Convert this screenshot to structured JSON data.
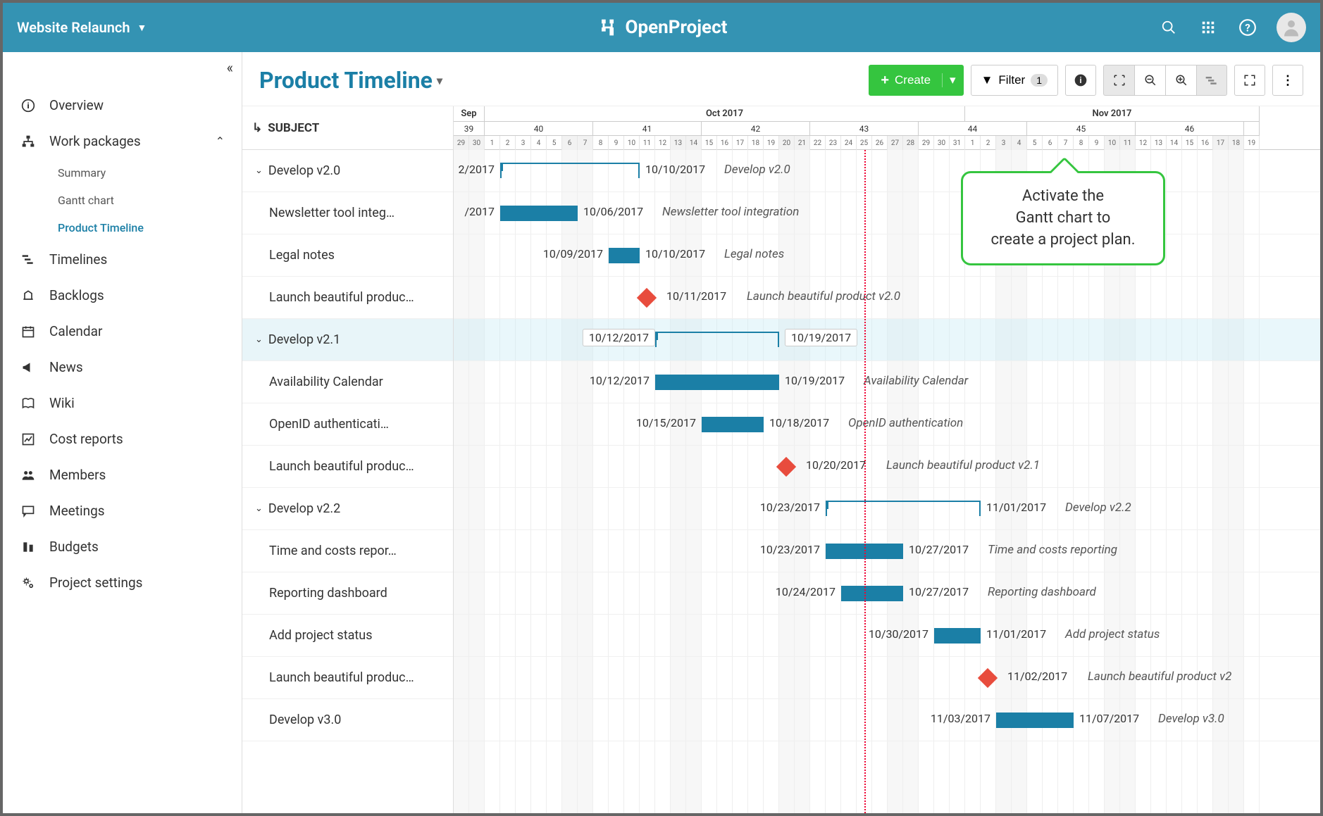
{
  "header": {
    "project_name": "Website Relaunch",
    "brand": "OpenProject"
  },
  "sidebar": {
    "items": [
      {
        "key": "overview",
        "label": "Overview",
        "icon": "info-circle"
      },
      {
        "key": "workpackages",
        "label": "Work packages",
        "icon": "sitemap",
        "expanded": true,
        "children": [
          {
            "key": "summary",
            "label": "Summary"
          },
          {
            "key": "gantt",
            "label": "Gantt chart"
          },
          {
            "key": "timeline",
            "label": "Product Timeline",
            "active": true
          }
        ]
      },
      {
        "key": "timelines",
        "label": "Timelines",
        "icon": "timeline"
      },
      {
        "key": "backlogs",
        "label": "Backlogs",
        "icon": "backlog"
      },
      {
        "key": "calendar",
        "label": "Calendar",
        "icon": "calendar"
      },
      {
        "key": "news",
        "label": "News",
        "icon": "bullhorn"
      },
      {
        "key": "wiki",
        "label": "Wiki",
        "icon": "book"
      },
      {
        "key": "costreports",
        "label": "Cost reports",
        "icon": "chart"
      },
      {
        "key": "members",
        "label": "Members",
        "icon": "members"
      },
      {
        "key": "meetings",
        "label": "Meetings",
        "icon": "comment"
      },
      {
        "key": "budgets",
        "label": "Budgets",
        "icon": "budget"
      },
      {
        "key": "settings",
        "label": "Project settings",
        "icon": "gears"
      }
    ]
  },
  "toolbar": {
    "title": "Product Timeline",
    "create_label": "Create",
    "filter_label": "Filter",
    "filter_count": "1"
  },
  "gantt": {
    "subject_header": "SUBJECT",
    "day_width": 22,
    "start_date": "2017-09-29",
    "months": [
      {
        "label": "Sep",
        "span": 2
      },
      {
        "label": "Oct 2017",
        "span": 31
      },
      {
        "label": "Nov 2017",
        "span": 19
      }
    ],
    "weeks": [
      {
        "label": "39",
        "span": 2
      },
      {
        "label": "40",
        "span": 7
      },
      {
        "label": "41",
        "span": 7
      },
      {
        "label": "42",
        "span": 7
      },
      {
        "label": "43",
        "span": 7
      },
      {
        "label": "44",
        "span": 7
      },
      {
        "label": "45",
        "span": 7
      },
      {
        "label": "46",
        "span": 7
      },
      {
        "label": "",
        "span": 1
      }
    ],
    "days": [
      "29",
      "30",
      "1",
      "2",
      "3",
      "4",
      "5",
      "6",
      "7",
      "8",
      "9",
      "10",
      "11",
      "12",
      "13",
      "14",
      "15",
      "16",
      "17",
      "18",
      "19",
      "20",
      "21",
      "22",
      "23",
      "24",
      "25",
      "26",
      "27",
      "28",
      "29",
      "30",
      "31",
      "1",
      "2",
      "3",
      "4",
      "5",
      "6",
      "7",
      "8",
      "9",
      "10",
      "11",
      "12",
      "13",
      "14",
      "15",
      "16",
      "17",
      "18",
      "19"
    ],
    "weekend_indices": [
      0,
      1,
      7,
      8,
      14,
      15,
      21,
      22,
      28,
      29,
      35,
      36,
      42,
      43,
      49,
      50
    ],
    "today_index": 26,
    "rows": [
      {
        "level": 0,
        "subject": "Develop v2.0",
        "type": "group",
        "start": 3,
        "end": 11,
        "start_label": "2/2017",
        "end_label": "10/10/2017",
        "task_label": "Develop v2.0"
      },
      {
        "level": 1,
        "subject": "Newsletter tool integ…",
        "type": "bar",
        "start": 3,
        "end": 7,
        "start_label": "/2017",
        "end_label": "10/06/2017",
        "task_label": "Newsletter tool integration"
      },
      {
        "level": 1,
        "subject": "Legal notes",
        "type": "bar",
        "start": 10,
        "end": 11,
        "start_label": "10/09/2017",
        "end_label": "10/10/2017",
        "task_label": "Legal notes"
      },
      {
        "level": 1,
        "subject": "Launch beautiful produc…",
        "type": "milestone",
        "at": 12,
        "end_label": "10/11/2017",
        "task_label": "Launch beautiful product v2.0"
      },
      {
        "level": 0,
        "subject": "Develop v2.1",
        "type": "group",
        "start": 13,
        "end": 20,
        "start_label": "10/12/2017",
        "end_label": "10/19/2017",
        "boxed": true,
        "highlighted": true
      },
      {
        "level": 1,
        "subject": "Availability Calendar",
        "type": "bar",
        "start": 13,
        "end": 20,
        "start_label": "10/12/2017",
        "end_label": "10/19/2017",
        "task_label": "Availability Calendar"
      },
      {
        "level": 1,
        "subject": "OpenID authenticati…",
        "type": "bar",
        "start": 16,
        "end": 19,
        "start_label": "10/15/2017",
        "end_label": "10/18/2017",
        "task_label": "OpenID authentication"
      },
      {
        "level": 1,
        "subject": "Launch beautiful produc…",
        "type": "milestone",
        "at": 21,
        "end_label": "10/20/2017",
        "task_label": "Launch beautiful product v2.1"
      },
      {
        "level": 0,
        "subject": "Develop v2.2",
        "type": "group",
        "start": 24,
        "end": 33,
        "start_label": "10/23/2017",
        "end_label": "11/01/2017",
        "task_label": "Develop v2.2"
      },
      {
        "level": 1,
        "subject": "Time and costs repor…",
        "type": "bar",
        "start": 24,
        "end": 28,
        "start_label": "10/23/2017",
        "end_label": "10/27/2017",
        "task_label": "Time and costs reporting"
      },
      {
        "level": 1,
        "subject": "Reporting dashboard",
        "type": "bar",
        "start": 25,
        "end": 28,
        "start_label": "10/24/2017",
        "end_label": "10/27/2017",
        "task_label": "Reporting dashboard"
      },
      {
        "level": 1,
        "subject": "Add project status",
        "type": "bar",
        "start": 31,
        "end": 33,
        "start_label": "10/30/2017",
        "end_label": "11/01/2017",
        "task_label": "Add project status"
      },
      {
        "level": 1,
        "subject": "Launch beautiful produc…",
        "type": "milestone",
        "at": 34,
        "end_label": "11/02/2017",
        "task_label": "Launch beautiful product v2"
      },
      {
        "level": 1,
        "subject": "Develop v3.0",
        "type": "bar",
        "start": 35,
        "end": 39,
        "start_label": "11/03/2017",
        "end_label": "11/07/2017",
        "task_label": "Develop v3.0"
      }
    ]
  },
  "callout": {
    "line1": "Activate the",
    "line2": "Gantt chart to",
    "line3": "create a project plan."
  }
}
